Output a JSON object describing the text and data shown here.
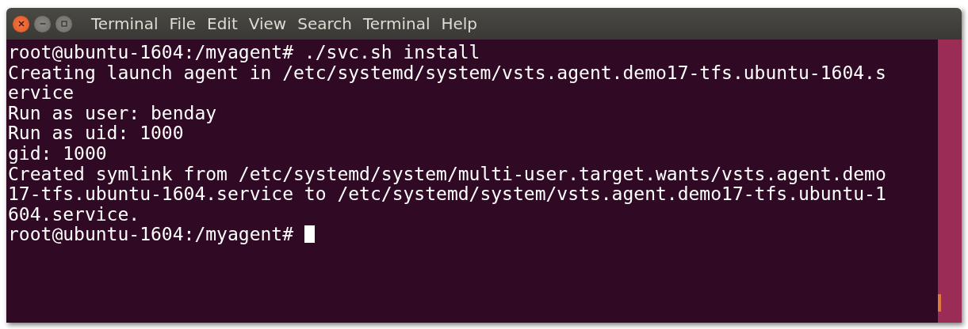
{
  "window": {
    "title": "Terminal"
  },
  "menu": [
    "File",
    "Edit",
    "View",
    "Search",
    "Terminal",
    "Help"
  ],
  "lines": [
    {
      "text": "root@ubuntu-1604:/myagent# ./svc.sh install",
      "cursor": false
    },
    {
      "text": "Creating launch agent in /etc/systemd/system/vsts.agent.demo17-tfs.ubuntu-1604.s",
      "cursor": false
    },
    {
      "text": "ervice",
      "cursor": false
    },
    {
      "text": "Run as user: benday",
      "cursor": false
    },
    {
      "text": "Run as uid: 1000",
      "cursor": false
    },
    {
      "text": "gid: 1000",
      "cursor": false
    },
    {
      "text": "Created symlink from /etc/systemd/system/multi-user.target.wants/vsts.agent.demo",
      "cursor": false
    },
    {
      "text": "17-tfs.ubuntu-1604.service to /etc/systemd/system/vsts.agent.demo17-tfs.ubuntu-1",
      "cursor": false
    },
    {
      "text": "604.service.",
      "cursor": false
    },
    {
      "text": "root@ubuntu-1604:/myagent# ",
      "cursor": true
    }
  ]
}
